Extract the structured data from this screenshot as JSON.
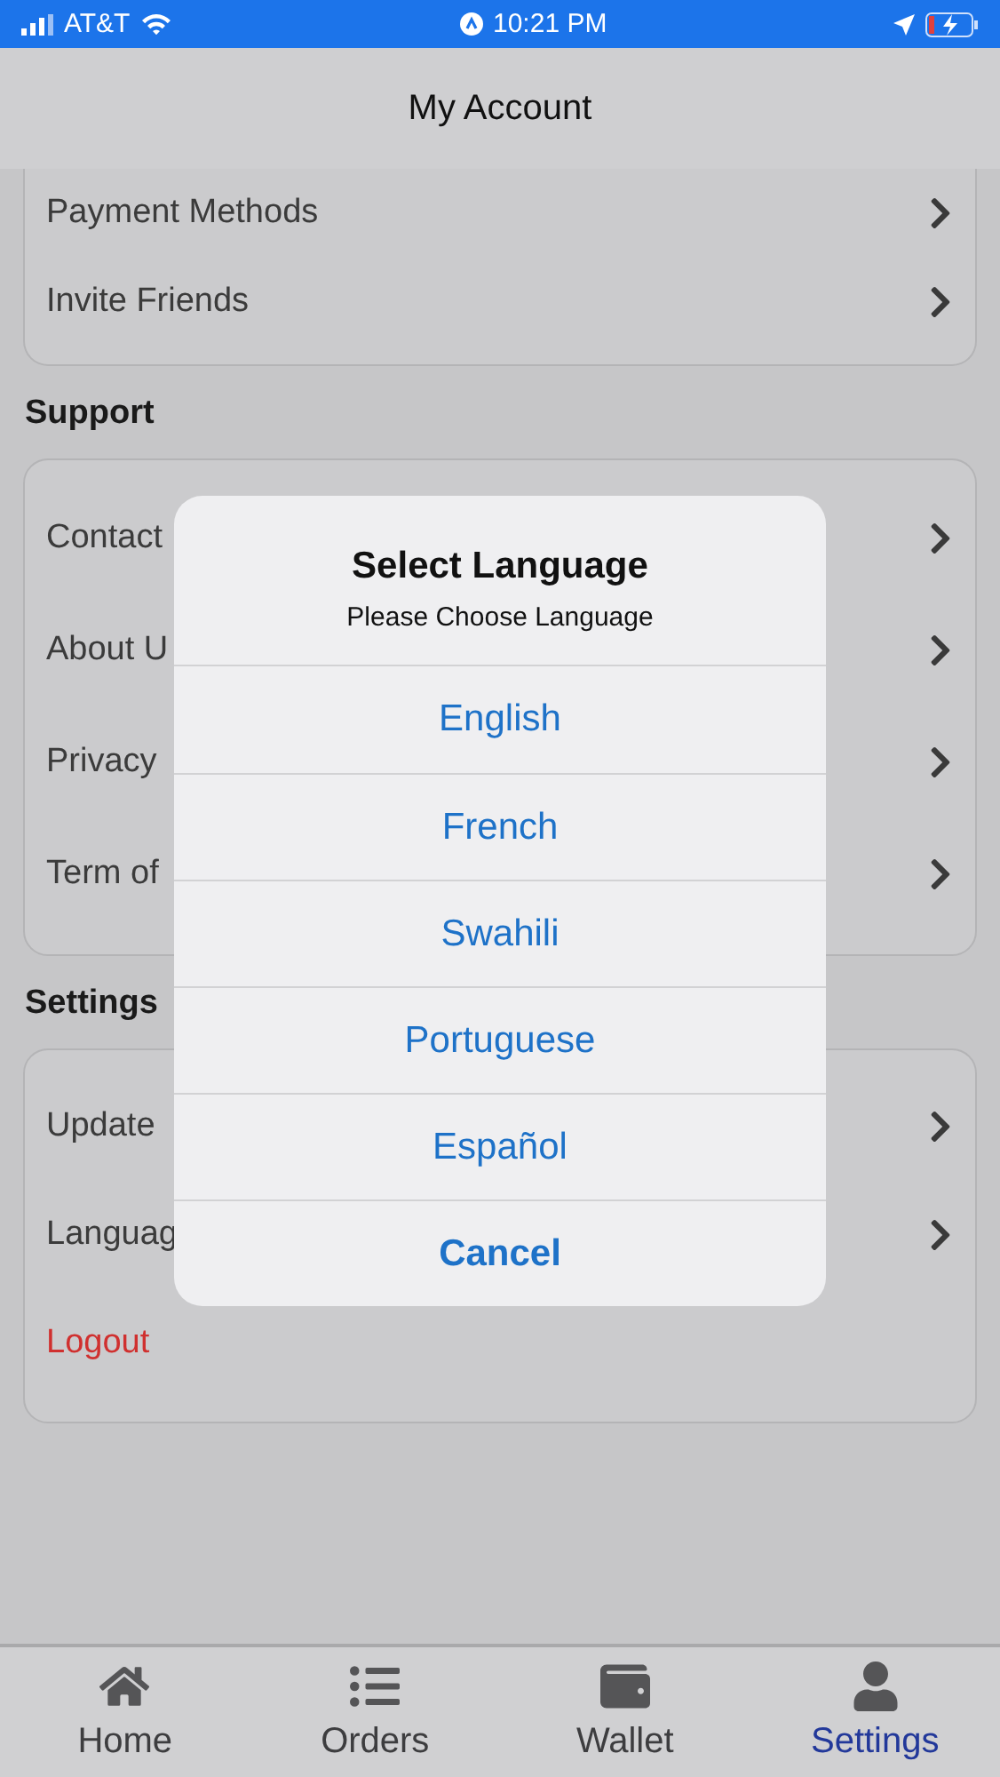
{
  "status_bar": {
    "carrier": "AT&T",
    "time": "10:21 PM"
  },
  "header": {
    "title": "My Account"
  },
  "sections": [
    {
      "items": [
        {
          "label": "Payment Methods",
          "kind": "link"
        },
        {
          "label": "Invite Friends",
          "kind": "link"
        }
      ]
    },
    {
      "title": "Support",
      "items": [
        {
          "label": "Contact",
          "kind": "link"
        },
        {
          "label": "About U",
          "kind": "link"
        },
        {
          "label": "Privacy",
          "kind": "link"
        },
        {
          "label": "Term of",
          "kind": "link"
        }
      ]
    },
    {
      "title": "Settings",
      "items": [
        {
          "label": "Update",
          "kind": "link"
        },
        {
          "label": "Languag",
          "kind": "link"
        },
        {
          "label": "Logout",
          "kind": "danger"
        }
      ]
    }
  ],
  "dialog": {
    "title": "Select Language",
    "message": "Please Choose Language",
    "options": [
      {
        "label": "English",
        "kind": "option"
      },
      {
        "label": "French",
        "kind": "option"
      },
      {
        "label": "Swahili",
        "kind": "option"
      },
      {
        "label": "Portuguese",
        "kind": "option"
      },
      {
        "label": "Español",
        "kind": "option"
      },
      {
        "label": "Cancel",
        "kind": "cancel"
      }
    ]
  },
  "tab_bar": [
    {
      "label": "Home",
      "kind": "home",
      "selected": false
    },
    {
      "label": "Orders",
      "kind": "orders",
      "selected": false
    },
    {
      "label": "Wallet",
      "kind": "wallet",
      "selected": false
    },
    {
      "label": "Settings",
      "kind": "user",
      "selected": true
    }
  ]
}
